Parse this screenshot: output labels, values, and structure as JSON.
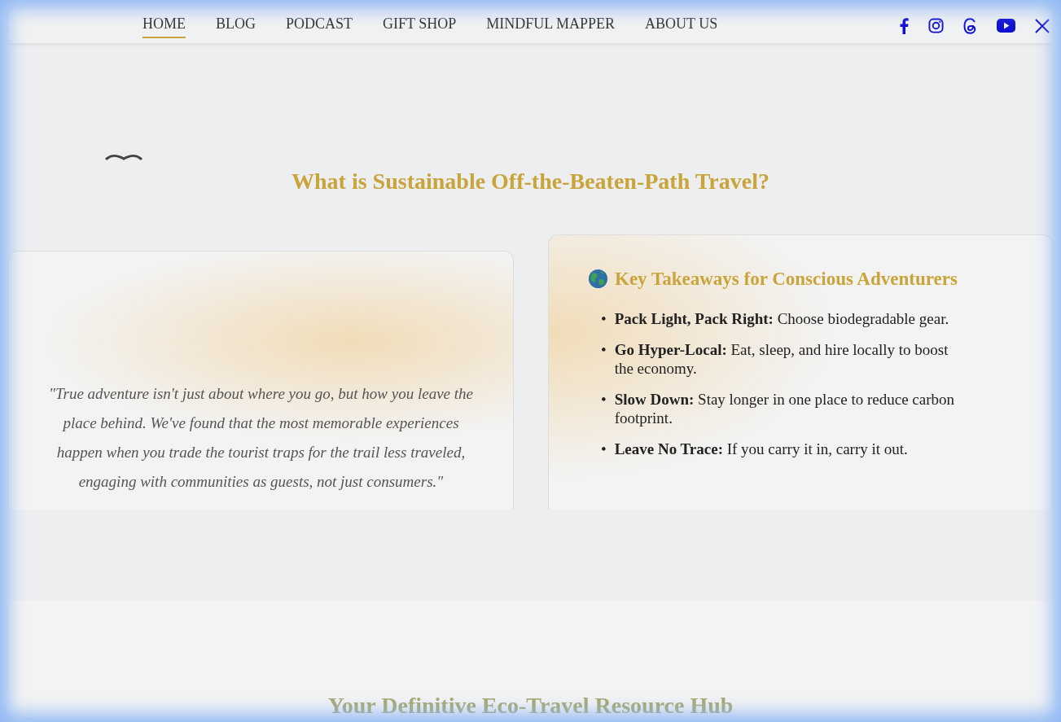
{
  "nav": {
    "links": [
      {
        "label": "HOME",
        "selected": true
      },
      {
        "label": "BLOG",
        "selected": false
      },
      {
        "label": "PODCAST",
        "selected": false
      },
      {
        "label": "GIFT SHOP",
        "selected": false
      },
      {
        "label": "MINDFUL MAPPER",
        "selected": false
      },
      {
        "label": "ABOUT US",
        "selected": false
      }
    ]
  },
  "intro": {
    "title": "What is Sustainable Off-the-Beaten-Path Travel?"
  },
  "quote": {
    "text": "\"True adventure isn't just about where you go, but how you leave the place behind. We've found that the most memorable experiences happen when you trade the tourist traps for the trail less traveled, engaging with communities as guests, not just consumers.\""
  },
  "takeaways": {
    "title": "Key Takeaways for Conscious Adventurers",
    "items": [
      {
        "marker": "•",
        "text": "**Pack Light, Pack Right:** Choose biodegradable gear."
      },
      {
        "marker": "•",
        "text": "**Go Hyper-Local:** Eat, sleep, and hire locally to boost the economy."
      },
      {
        "marker": "•",
        "text": "**Slow Down:** Stay longer in one place to reduce carbon footprint."
      },
      {
        "marker": "•",
        "text": "**Leave No Trace:** If you carry it in, carry it out."
      }
    ]
  },
  "resources": {
    "title": "Your Definitive Eco-Travel Resource Hub"
  }
}
